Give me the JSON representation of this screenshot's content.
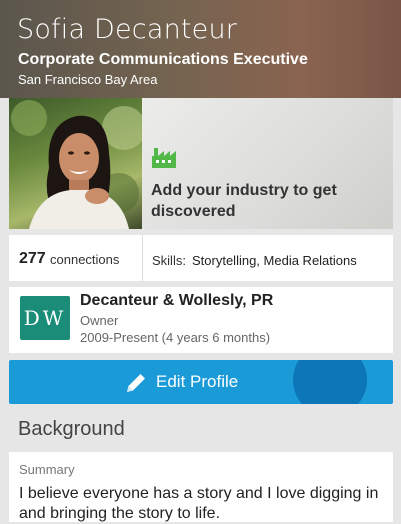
{
  "profile": {
    "name": "Sofia Decanteur",
    "title": "Corporate Communications Executive",
    "location": "San Francisco Bay Area"
  },
  "industry_prompt": {
    "text": "Add your industry to get discovered",
    "icon": "factory-icon",
    "accent": "#52b848"
  },
  "stats": {
    "connections_count": "277",
    "connections_label": "connections",
    "skills_label": "Skills:",
    "skills_value": "Storytelling, Media Relations"
  },
  "company": {
    "logo_text": "DW",
    "name": "Decanteur & Wollesly, PR",
    "role": "Owner",
    "dates": "2009-Present (4 years 6 months)"
  },
  "edit_button": {
    "label": "Edit Profile",
    "icon": "pencil-icon",
    "color": "#1b9ad8"
  },
  "background": {
    "title": "Background",
    "summary_label": "Summary",
    "summary_text": "I believe everyone has a story and I love digging in and bringing the story to life."
  }
}
